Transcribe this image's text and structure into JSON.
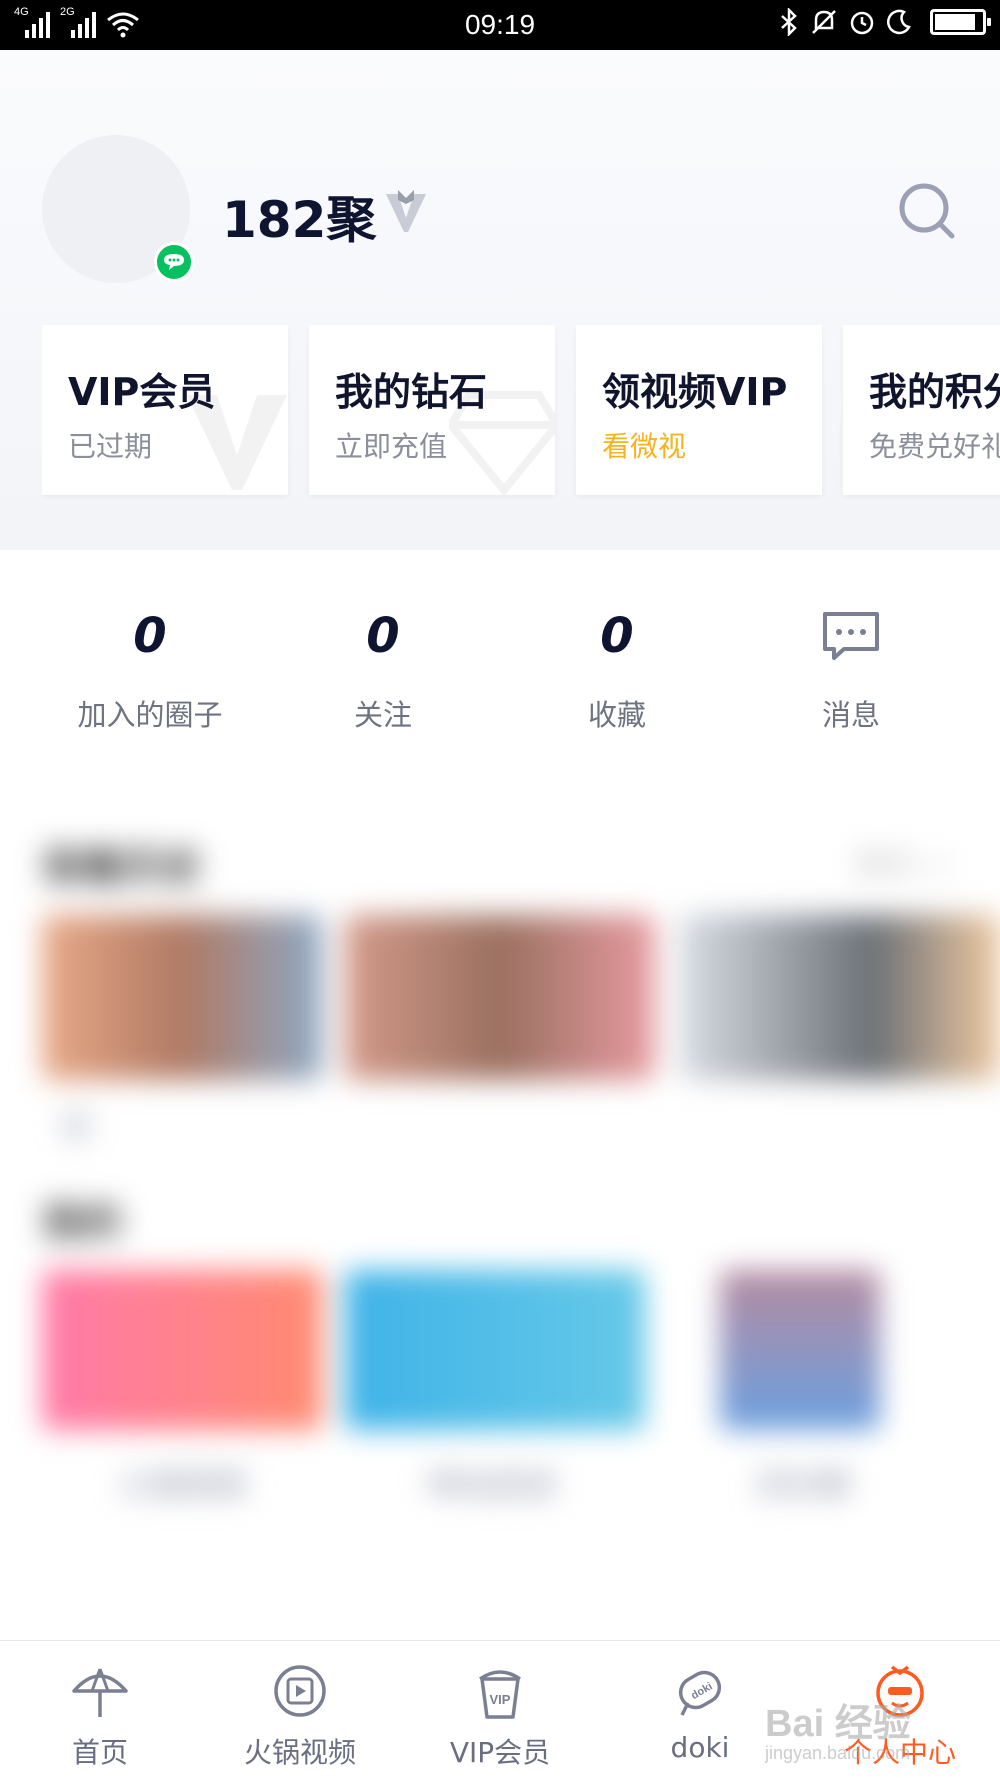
{
  "status_bar": {
    "time": "09:19",
    "network_1": "4G",
    "network_2": "2G"
  },
  "profile": {
    "username": "182聚",
    "login_badge_icon": "wechat-icon",
    "vip_icon": "vip-v-icon"
  },
  "cards": [
    {
      "title": "VIP会员",
      "subtitle": "已过期",
      "accent": false
    },
    {
      "title": "我的钻石",
      "subtitle": "立即充值",
      "accent": false
    },
    {
      "title": "领视频VIP",
      "subtitle": "看微视",
      "accent": true
    },
    {
      "title": "我的积分",
      "subtitle": "免费兑好礼",
      "accent": false
    }
  ],
  "stats": [
    {
      "value": "0",
      "label": "加入的圈子"
    },
    {
      "value": "0",
      "label": "关注"
    },
    {
      "value": "0",
      "label": "收藏"
    },
    {
      "value": "",
      "label": "消息"
    }
  ],
  "history": {
    "title": "观看历史",
    "more": "更多 >",
    "item_caption": "全"
  },
  "apps": {
    "title": "我的",
    "items": [
      "火锅视频",
      "咪咕阅读",
      "灵剑尊"
    ]
  },
  "tabbar": {
    "items": [
      {
        "label": "首页",
        "icon": "umbrella-icon",
        "active": false
      },
      {
        "label": "火锅视频",
        "icon": "video-reel-icon",
        "active": false
      },
      {
        "label": "VIP会员",
        "icon": "vip-cup-icon",
        "active": false
      },
      {
        "label": "doki",
        "icon": "doki-icon",
        "active": false
      },
      {
        "label": "个人中心",
        "icon": "profile-face-icon",
        "active": true
      }
    ]
  },
  "watermark": {
    "text": "Bai 经验",
    "sub": "jingyan.baidu.com"
  },
  "colors": {
    "accent_orange": "#ff5a1f",
    "gold": "#f5b31d",
    "wechat_green": "#07c160",
    "dark_text": "#0f1431"
  }
}
